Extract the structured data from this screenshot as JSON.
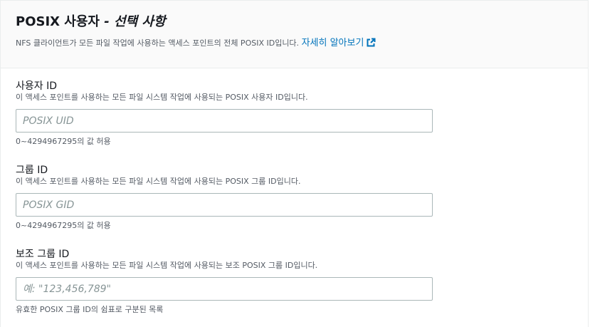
{
  "header": {
    "title": "POSIX 사용자",
    "separator": " - ",
    "optional": "선택 사항",
    "description": "NFS 클라이언트가 모든 파일 작업에 사용하는 액세스 포인트의 전체 POSIX ID입니다.",
    "learn_more": "자세히 알아보기",
    "learn_more_icon": "external-link-icon",
    "accent_color": "#0073bb"
  },
  "fields": [
    {
      "label": "사용자 ID",
      "description": "이 액세스 포인트를 사용하는 모든 파일 시스템 작업에 사용되는 POSIX 사용자 ID입니다.",
      "value": "",
      "placeholder": "POSIX UID",
      "constraint": "0~4294967295의 값 허용"
    },
    {
      "label": "그룹 ID",
      "description": "이 액세스 포인트를 사용하는 모든 파일 시스템 작업에 사용되는 POSIX 그룹 ID입니다.",
      "value": "",
      "placeholder": "POSIX GID",
      "constraint": "0~4294967295의 값 허용"
    },
    {
      "label": "보조 그룹 ID",
      "description": "이 액세스 포인트를 사용하는 모든 파일 시스템 작업에 사용되는 보조 POSIX 그룹 ID입니다.",
      "value": "",
      "placeholder": "예: \"123,456,789\"",
      "constraint": "유효한 POSIX 그룹 ID의 쉼표로 구분된 목록"
    }
  ]
}
